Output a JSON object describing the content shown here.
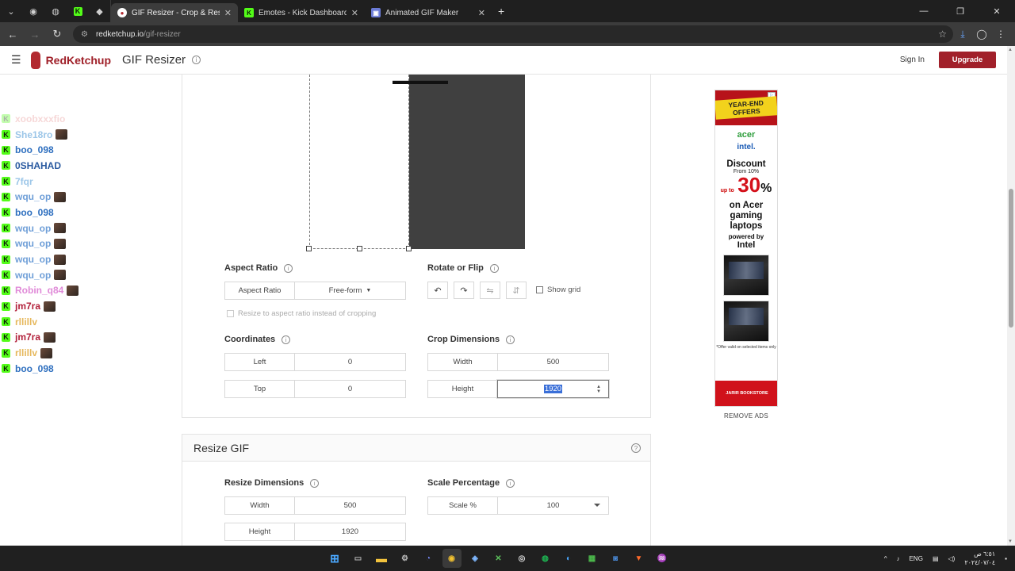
{
  "browser": {
    "tabs": [
      {
        "title": "GIF Resizer - Crop & Resize Ani",
        "active": true
      },
      {
        "title": "Emotes - Kick Dashboard",
        "active": false
      },
      {
        "title": "Animated GIF Maker",
        "active": false
      }
    ],
    "url_host": "redketchup.io",
    "url_path": "/gif-resizer"
  },
  "header": {
    "brand": "RedKetchup",
    "tool_title": "GIF Resizer",
    "sign_in": "Sign In",
    "upgrade": "Upgrade"
  },
  "chat": {
    "messages": [
      {
        "user": "xoobxxxfio",
        "color": "#e89090",
        "emote": false,
        "faded": true
      },
      {
        "user": "She18ro",
        "color": "#9cc6e8",
        "emote": true,
        "faded": false
      },
      {
        "user": "boo_098",
        "color": "#2e6fbf",
        "emote": false,
        "faded": false
      },
      {
        "user": "0SHAHAD",
        "color": "#2a5aa0",
        "emote": false,
        "faded": false
      },
      {
        "user": "7fqr",
        "color": "#9cc6e8",
        "emote": false,
        "faded": false
      },
      {
        "user": "wqu_op",
        "color": "#6f9fd8",
        "emote": true,
        "faded": false
      },
      {
        "user": "boo_098",
        "color": "#2e6fbf",
        "emote": false,
        "faded": false
      },
      {
        "user": "wqu_op",
        "color": "#6f9fd8",
        "emote": true,
        "faded": false
      },
      {
        "user": "wqu_op",
        "color": "#6f9fd8",
        "emote": true,
        "faded": false
      },
      {
        "user": "wqu_op",
        "color": "#6f9fd8",
        "emote": true,
        "faded": false
      },
      {
        "user": "wqu_op",
        "color": "#6f9fd8",
        "emote": true,
        "faded": false
      },
      {
        "user": "Robin_q84",
        "color": "#e08ad8",
        "emote": true,
        "faded": false
      },
      {
        "user": "jm7ra",
        "color": "#b2203a",
        "emote": true,
        "faded": false
      },
      {
        "user": "rllillv",
        "color": "#e6b85c",
        "emote": false,
        "faded": false
      },
      {
        "user": "jm7ra",
        "color": "#b2203a",
        "emote": true,
        "faded": false
      },
      {
        "user": "rllillv",
        "color": "#e6b85c",
        "emote": true,
        "faded": false
      },
      {
        "user": "boo_098",
        "color": "#2e6fbf",
        "emote": false,
        "faded": false
      }
    ]
  },
  "crop": {
    "aspect_ratio": {
      "title": "Aspect Ratio",
      "label": "Aspect Ratio",
      "value": "Free-form",
      "resize_checkbox": "Resize to aspect ratio instead of cropping"
    },
    "rotate": {
      "title": "Rotate or Flip",
      "show_grid": "Show grid"
    },
    "coordinates": {
      "title": "Coordinates",
      "left_label": "Left",
      "left_value": "0",
      "top_label": "Top",
      "top_value": "0"
    },
    "dimensions": {
      "title": "Crop Dimensions",
      "width_label": "Width",
      "width_value": "500",
      "height_label": "Height",
      "height_value": "1920"
    }
  },
  "resize": {
    "title": "Resize GIF",
    "dimensions": {
      "title": "Resize Dimensions",
      "width_label": "Width",
      "width_value": "500",
      "height_label": "Height",
      "height_value": "1920"
    },
    "scale": {
      "title": "Scale Percentage",
      "label": "Scale %",
      "value": "100"
    }
  },
  "ad": {
    "badge": "YEAR-END OFFERS",
    "brand1": "acer",
    "brand2": "intel.",
    "discount": "Discount",
    "from": "From 10%",
    "upto": "up to",
    "percent": "30",
    "percent_sign": "%",
    "line1": "on Acer gaming laptops",
    "powered": "powered by",
    "brand3": "Intel",
    "offer_note": "*Offer valid on selected items only",
    "store": "JARIR BOOKSTORE",
    "remove": "REMOVE ADS"
  },
  "taskbar": {
    "lang": "ENG",
    "time": "٦:٥١ ص",
    "date": "٢٠٢٤/٠٧/٠٤"
  }
}
